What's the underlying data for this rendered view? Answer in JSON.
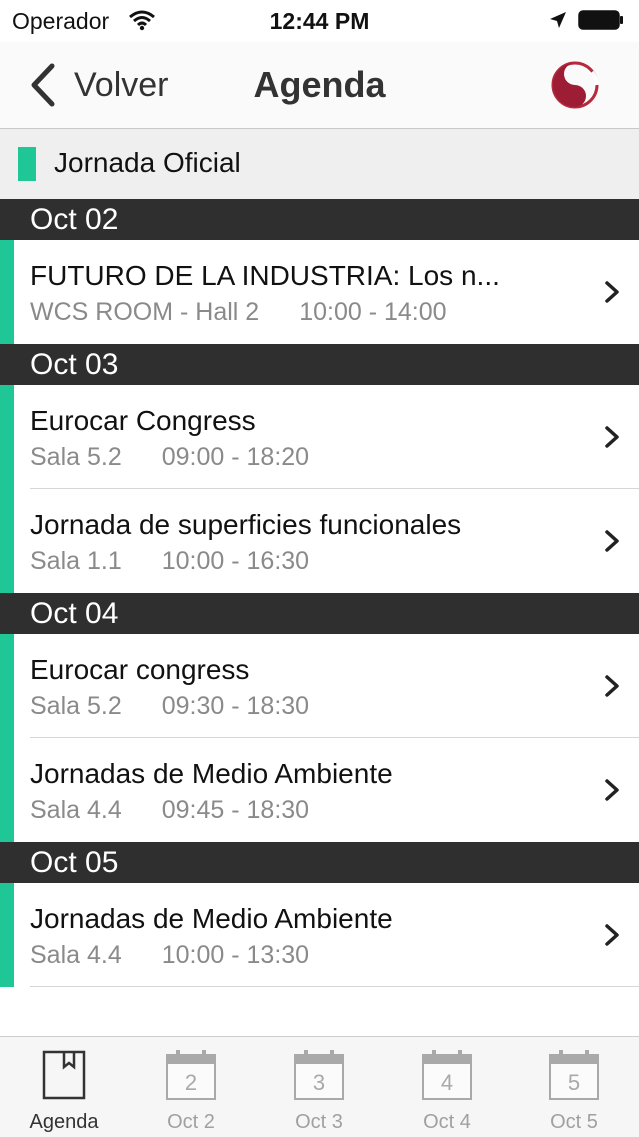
{
  "status_bar": {
    "carrier": "Operador",
    "time": "12:44 PM"
  },
  "nav": {
    "back_label": "Volver",
    "title": "Agenda"
  },
  "category": {
    "label": "Jornada Oficial",
    "color": "#1ec795"
  },
  "days": [
    {
      "label": "Oct 02",
      "events": [
        {
          "title": "FUTURO DE LA INDUSTRIA: Los n...",
          "room": "WCS ROOM - Hall 2",
          "time": "10:00 - 14:00"
        }
      ]
    },
    {
      "label": "Oct 03",
      "events": [
        {
          "title": "Eurocar Congress",
          "room": "Sala 5.2",
          "time": "09:00 - 18:20"
        },
        {
          "title": "Jornada de superficies funcionales",
          "room": "Sala 1.1",
          "time": "10:00 - 16:30"
        }
      ]
    },
    {
      "label": "Oct 04",
      "events": [
        {
          "title": "Eurocar congress",
          "room": "Sala 5.2",
          "time": "09:30 - 18:30"
        },
        {
          "title": "Jornadas de Medio Ambiente",
          "room": "Sala 4.4",
          "time": "09:45 - 18:30"
        }
      ]
    },
    {
      "label": "Oct 05",
      "events": [
        {
          "title": "Jornadas de Medio Ambiente",
          "room": "Sala 4.4",
          "time": "10:00 - 13:30"
        }
      ]
    }
  ],
  "tabs": [
    {
      "label": "Agenda",
      "icon": "book-icon",
      "active": true
    },
    {
      "label": "Oct 2",
      "icon": "calendar-icon",
      "number": "2"
    },
    {
      "label": "Oct 3",
      "icon": "calendar-icon",
      "number": "3"
    },
    {
      "label": "Oct 4",
      "icon": "calendar-icon",
      "number": "4"
    },
    {
      "label": "Oct 5",
      "icon": "calendar-icon",
      "number": "5"
    }
  ]
}
